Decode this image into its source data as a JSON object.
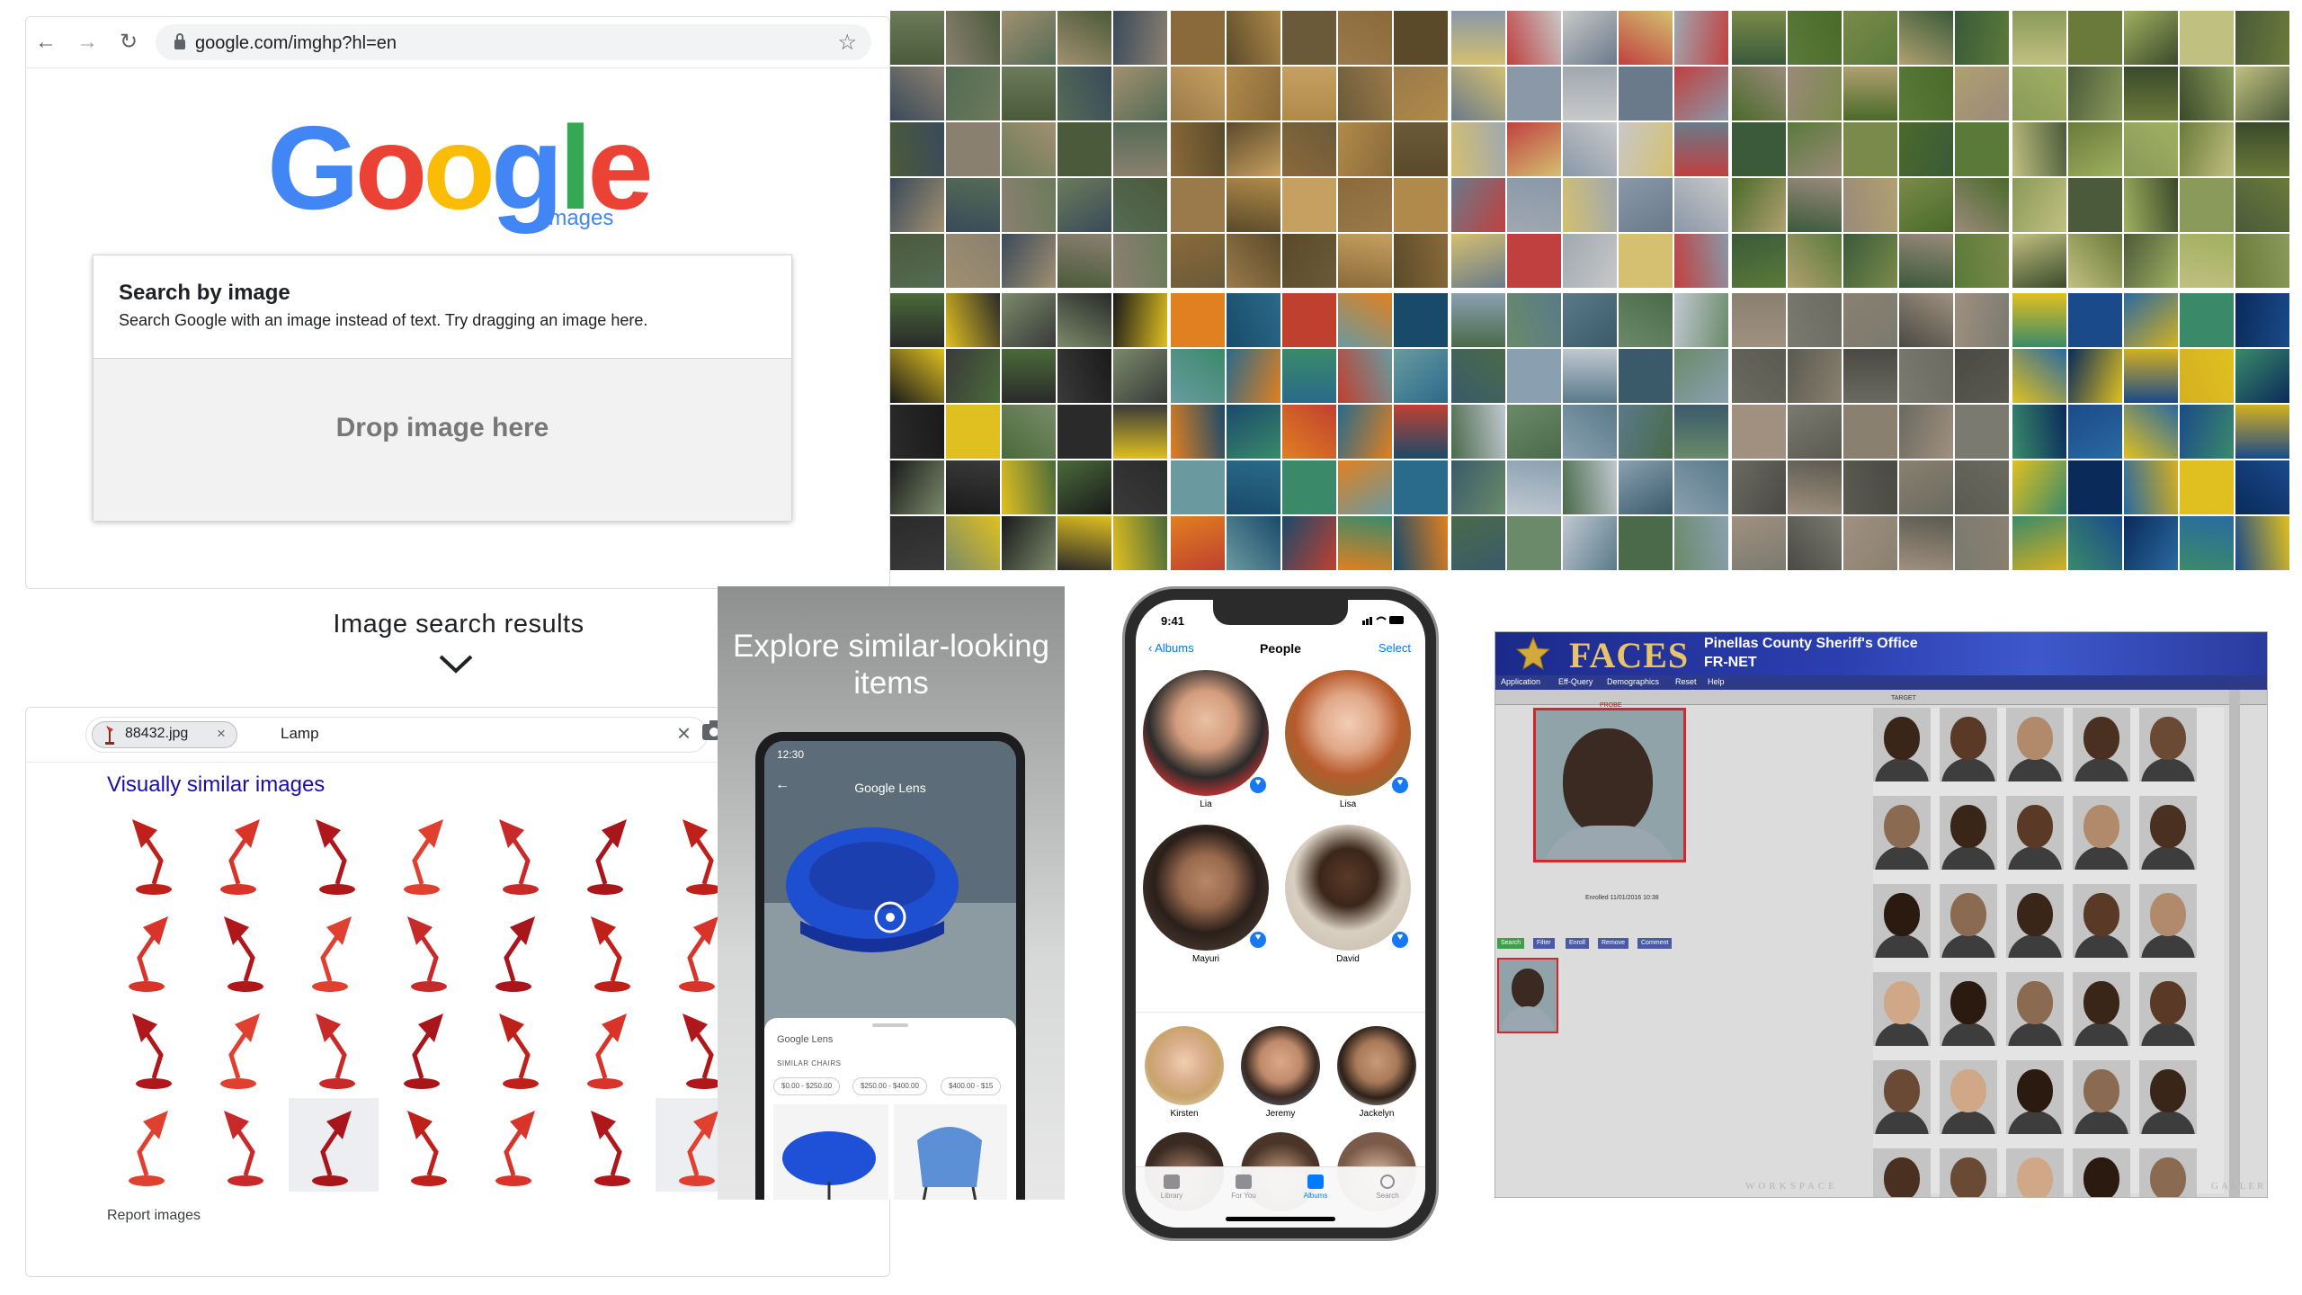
{
  "google_images": {
    "url": "google.com/imghp?hl=en",
    "logo_letters": [
      "G",
      "o",
      "o",
      "g",
      "l",
      "e"
    ],
    "logo_colors": [
      "#4285f4",
      "#ea4335",
      "#fbbc05",
      "#4285f4",
      "#34a853",
      "#ea4335"
    ],
    "logo_subtitle": "images",
    "card_title": "Search by image",
    "card_description": "Search Google with an image instead of text. Try dragging an image here.",
    "drop_label": "Drop image here"
  },
  "results_section": {
    "heading": "Image search results",
    "file_chip": "88432.jpg",
    "query": "Lamp",
    "similar_heading": "Visually similar images",
    "report_link": "Report images"
  },
  "lens": {
    "headline": "Explore similar-looking items",
    "status_time": "12:30",
    "app_title": "Google Lens",
    "sheet_brand": "Google Lens",
    "sheet_category": "SIMILAR CHAIRS",
    "prices": [
      "$0.00 - $250.00",
      "$250.00 - $400.00",
      "$400.00 - $15"
    ]
  },
  "photos": {
    "time": "9:41",
    "back": "Albums",
    "title": "People",
    "select": "Select",
    "people": [
      "Lia",
      "Lisa",
      "Mayuri",
      "David",
      "Kirsten",
      "Jeremy",
      "Jackelyn"
    ],
    "tabs": [
      "Library",
      "For You",
      "Albums",
      "Search"
    ]
  },
  "faces": {
    "brand": "FACES",
    "agency": "Pinellas County Sheriff's Office",
    "network": "FR-NET",
    "menu": [
      "Application",
      "Eff-Query",
      "Demographics",
      "Reset",
      "Help"
    ],
    "probe_label": "PROBE",
    "target_label": "TARGET",
    "enrolled": "Enrolled 11/01/2016 10:38",
    "buttons": [
      "Search",
      "Filter",
      "Enroll",
      "Remove",
      "Comment"
    ],
    "watermark": "WORKSPACE",
    "gallery": "GALLERY"
  }
}
